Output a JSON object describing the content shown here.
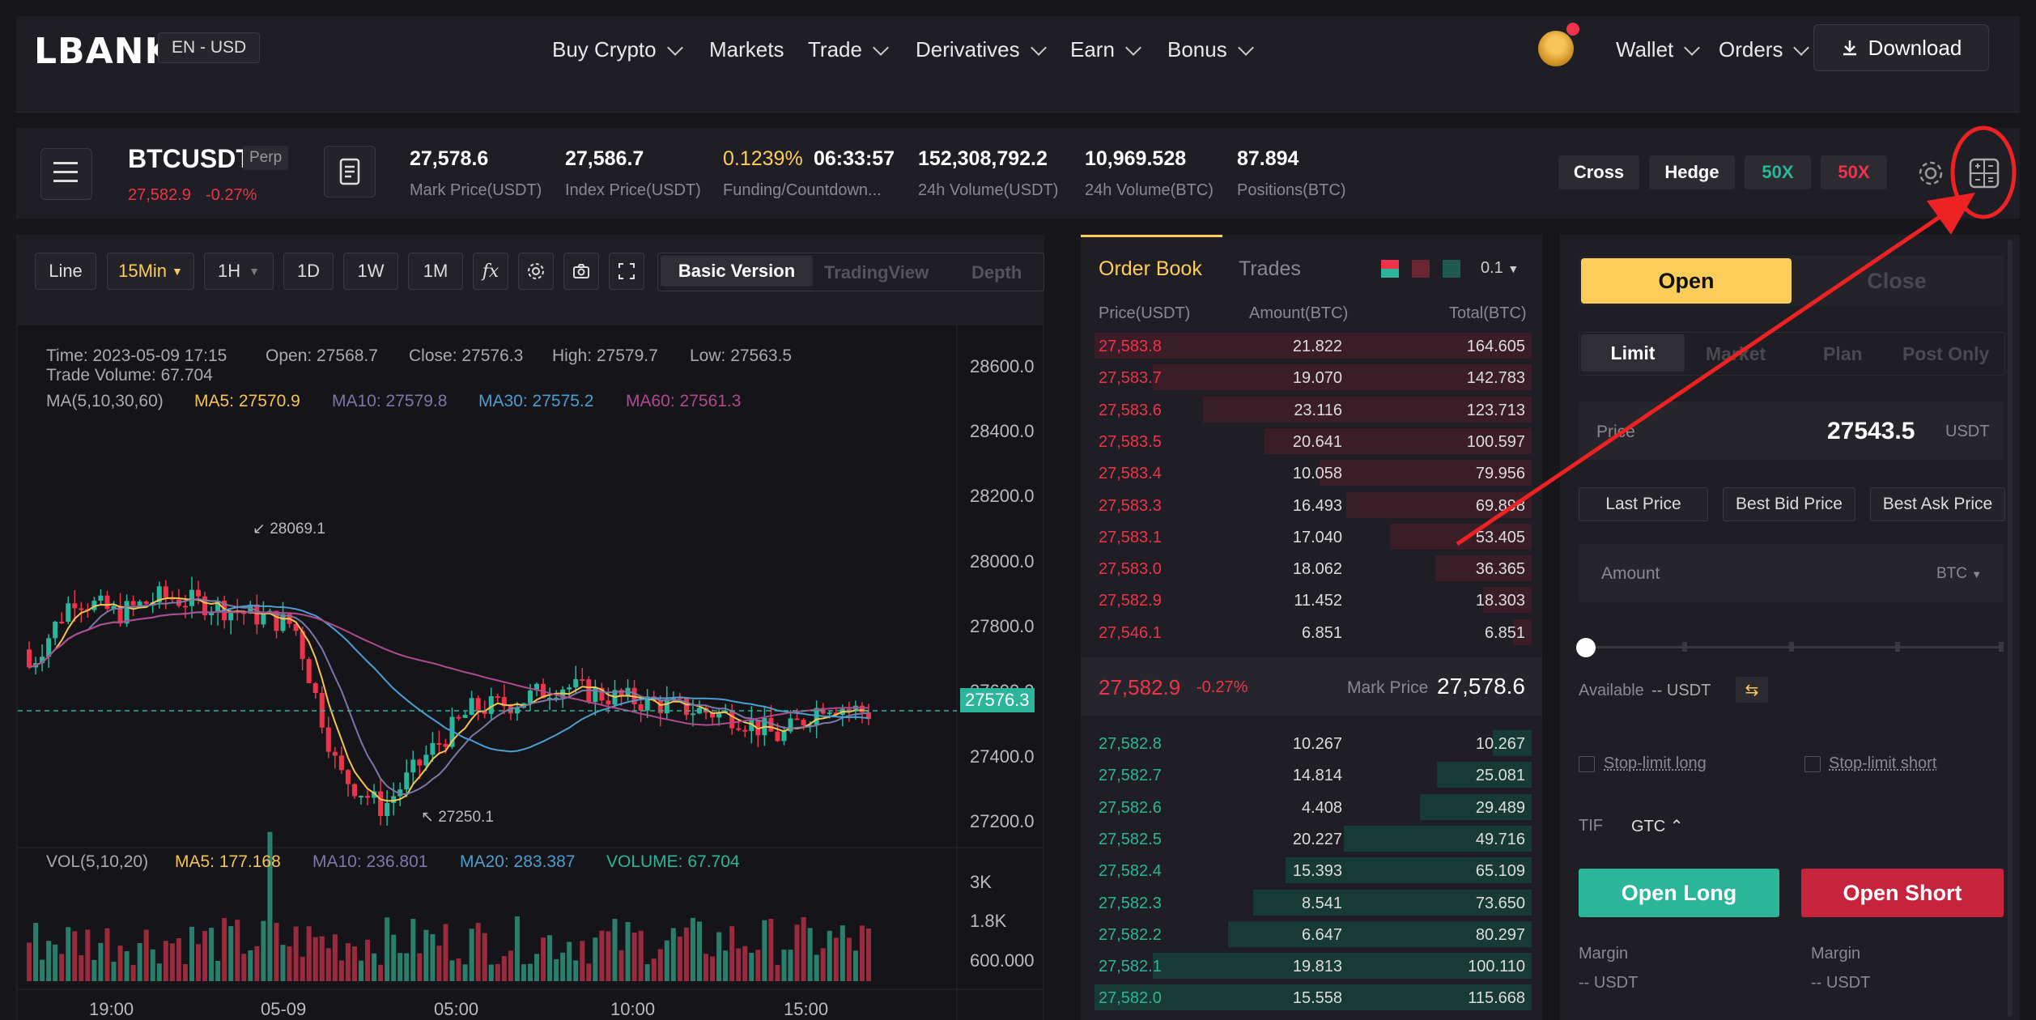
{
  "nav": {
    "logo": "LBANK",
    "lang": "EN - USD",
    "items": [
      "Buy Crypto",
      "Markets",
      "Trade",
      "Derivatives",
      "Earn",
      "Bonus"
    ],
    "wallet": "Wallet",
    "orders": "Orders",
    "download": "Download"
  },
  "ticker": {
    "symbol": "BTCUSDT",
    "perp": "Perp",
    "last_price": "27,582.9",
    "change": "-0.27%",
    "mark_price": "27,578.6",
    "mark_label": "Mark Price(USDT)",
    "index_price": "27,586.7",
    "index_label": "Index Price(USDT)",
    "funding": "0.1239%",
    "countdown": "06:33:57",
    "funding_label": "Funding/Countdown...",
    "vol_usdt": "152,308,792.2",
    "vol_usdt_label": "24h Volume(USDT)",
    "vol_btc": "10,969.528",
    "vol_btc_label": "24h Volume(BTC)",
    "positions": "87.894",
    "positions_label": "Positions(BTC)",
    "cross": "Cross",
    "hedge": "Hedge",
    "lev_long": "50X",
    "lev_short": "50X"
  },
  "chart_toolbar": {
    "line": "Line",
    "interval": "15Min",
    "h1": "1H",
    "d1": "1D",
    "w1": "1W",
    "m1": "1M",
    "fx": "fx",
    "basic": "Basic Version",
    "tradingview": "TradingView",
    "depth": "Depth"
  },
  "chart_info": {
    "time": "Time: 2023-05-09 17:15",
    "open": "Open: 27568.7",
    "close": "Close: 27576.3",
    "high": "High: 27579.7",
    "low": "Low: 27563.5",
    "trade_volume": "Trade Volume: 67.704",
    "ma_label": "MA(5,10,30,60)",
    "ma5": "MA5: 27570.9",
    "ma10": "MA10: 27579.8",
    "ma30": "MA30: 27575.2",
    "ma60": "MA60: 27561.3",
    "high_mark": "28069.1",
    "low_mark": "27250.1",
    "current": "27576.3",
    "vol_label": "VOL(5,10,20)",
    "vma5": "MA5: 177.168",
    "vma10": "MA10: 236.801",
    "vma20": "MA20: 283.387",
    "volume": "VOLUME: 67.704",
    "y_ticks": [
      "28600.0",
      "28400.0",
      "28200.0",
      "28000.0",
      "27800.0",
      "27600.0",
      "27400.0",
      "27200.0"
    ],
    "vol_ticks": [
      "3K",
      "1.8K",
      "600.000"
    ],
    "x_ticks": [
      "19:00",
      "05-09",
      "05:00",
      "10:00",
      "15:00"
    ]
  },
  "chart_data": {
    "type": "candlestick",
    "x": [
      "05-08 17:00",
      "05-09 17:15"
    ],
    "ylim": [
      27200,
      28600
    ],
    "high_marker": 28069.1,
    "low_marker": 27250.1,
    "last_close": 27576.3
  },
  "orderbook": {
    "tab_book": "Order Book",
    "tab_trades": "Trades",
    "precision": "0.1",
    "col_price": "Price(USDT)",
    "col_amount": "Amount(BTC)",
    "col_total": "Total(BTC)",
    "asks": [
      {
        "price": "27,583.8",
        "amount": "21.822",
        "total": "164.605",
        "depth": 1.0
      },
      {
        "price": "27,583.7",
        "amount": "19.070",
        "total": "142.783",
        "depth": 0.867
      },
      {
        "price": "27,583.6",
        "amount": "23.116",
        "total": "123.713",
        "depth": 0.752
      },
      {
        "price": "27,583.5",
        "amount": "20.641",
        "total": "100.597",
        "depth": 0.611
      },
      {
        "price": "27,583.4",
        "amount": "10.058",
        "total": "79.956",
        "depth": 0.486
      },
      {
        "price": "27,583.3",
        "amount": "16.493",
        "total": "69.898",
        "depth": 0.425
      },
      {
        "price": "27,583.1",
        "amount": "17.040",
        "total": "53.405",
        "depth": 0.324
      },
      {
        "price": "27,583.0",
        "amount": "18.062",
        "total": "36.365",
        "depth": 0.221
      },
      {
        "price": "27,582.9",
        "amount": "11.452",
        "total": "18.303",
        "depth": 0.111
      },
      {
        "price": "27,546.1",
        "amount": "6.851",
        "total": "6.851",
        "depth": 0.042
      }
    ],
    "last": "27,582.9",
    "last_change": "-0.27%",
    "mark_label": "Mark Price",
    "mark": "27,578.6",
    "bids": [
      {
        "price": "27,582.8",
        "amount": "10.267",
        "total": "10.267",
        "depth": 0.089
      },
      {
        "price": "27,582.7",
        "amount": "14.814",
        "total": "25.081",
        "depth": 0.217
      },
      {
        "price": "27,582.6",
        "amount": "4.408",
        "total": "29.489",
        "depth": 0.255
      },
      {
        "price": "27,582.5",
        "amount": "20.227",
        "total": "49.716",
        "depth": 0.43
      },
      {
        "price": "27,582.4",
        "amount": "15.393",
        "total": "65.109",
        "depth": 0.563
      },
      {
        "price": "27,582.3",
        "amount": "8.541",
        "total": "73.650",
        "depth": 0.637
      },
      {
        "price": "27,582.2",
        "amount": "6.647",
        "total": "80.297",
        "depth": 0.694
      },
      {
        "price": "27,582.1",
        "amount": "19.813",
        "total": "100.110",
        "depth": 0.866
      },
      {
        "price": "27,582.0",
        "amount": "15.558",
        "total": "115.668",
        "depth": 1.0
      }
    ]
  },
  "trade": {
    "open": "Open",
    "close": "Close",
    "limit": "Limit",
    "market": "Market",
    "plan": "Plan",
    "post_only": "Post Only",
    "price_label": "Price",
    "price_value": "27543.5",
    "unit": "USDT",
    "last_price": "Last Price",
    "best_bid": "Best Bid Price",
    "best_ask": "Best Ask Price",
    "amount_label": "Amount",
    "amount_unit": "BTC",
    "available": "Available",
    "available_value": "-- USDT",
    "stop_long": "Stop-limit long",
    "stop_short": "Stop-limit short",
    "tif": "TIF",
    "tif_value": "GTC",
    "open_long": "Open Long",
    "open_short": "Open Short",
    "margin": "Margin",
    "margin_value": "-- USDT"
  },
  "colors": {
    "up": "#2bb59a",
    "down": "#f0334a",
    "accent": "#fccd5a",
    "bg": "#17161b"
  }
}
